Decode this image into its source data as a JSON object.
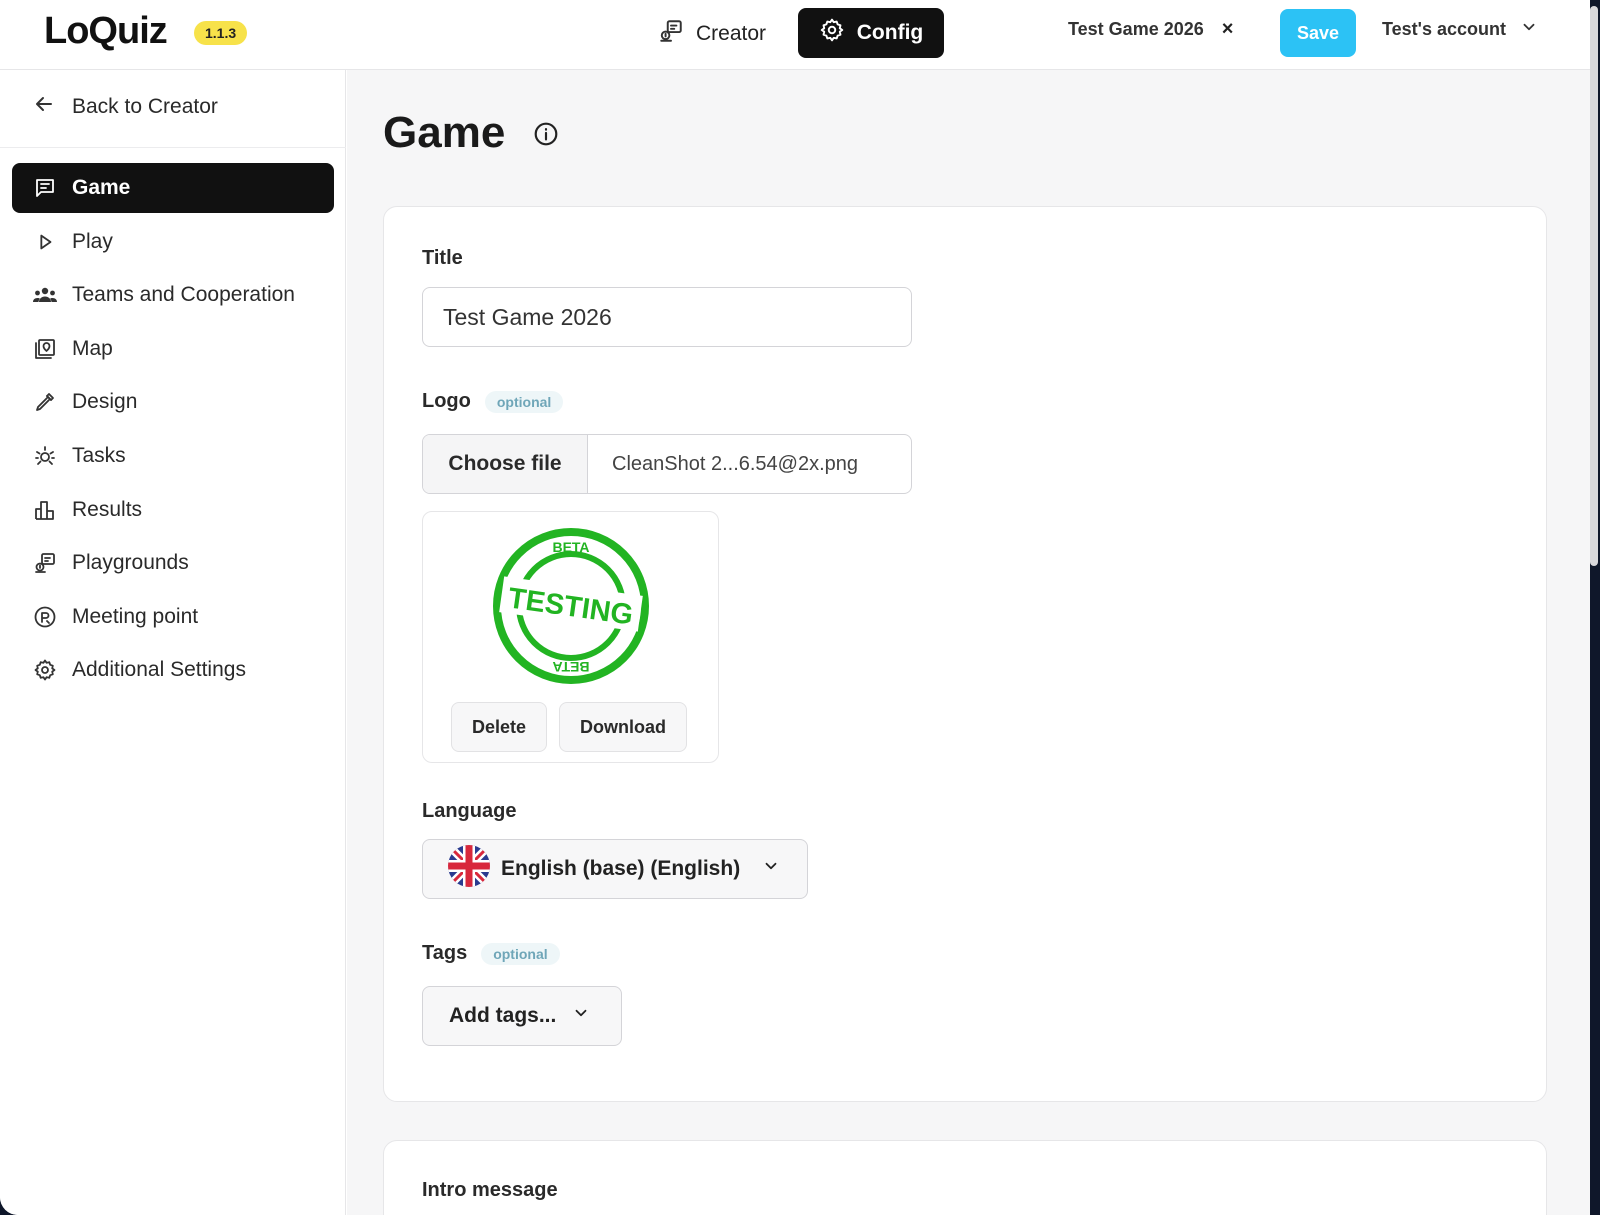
{
  "header": {
    "logo": "LoQuiz",
    "version": "1.1.3",
    "nav_creator": "Creator",
    "nav_config": "Config",
    "game_tab": "Test Game 2026",
    "close_glyph": "×",
    "save_label": "Save",
    "account_label": "Test's account"
  },
  "sidebar": {
    "back_label": "Back to Creator",
    "items": [
      {
        "label": "Game",
        "icon": "message-square-icon",
        "active": true
      },
      {
        "label": "Play",
        "icon": "play-icon"
      },
      {
        "label": "Teams and Cooperation",
        "icon": "users-icon"
      },
      {
        "label": "Map",
        "icon": "map-pin-icon"
      },
      {
        "label": "Design",
        "icon": "pipette-icon"
      },
      {
        "label": "Tasks",
        "icon": "sparkle-icon"
      },
      {
        "label": "Results",
        "icon": "bar-chart-icon"
      },
      {
        "label": "Playgrounds",
        "icon": "playground-icon"
      },
      {
        "label": "Meeting point",
        "icon": "meeting-point-icon"
      },
      {
        "label": "Additional Settings",
        "icon": "gear-icon"
      }
    ]
  },
  "main": {
    "page_title": "Game",
    "title_label": "Title",
    "title_value": "Test Game 2026",
    "logo_label": "Logo",
    "optional_badge": "optional",
    "choose_file_label": "Choose file",
    "file_name": "CleanShot 2...6.54@2x.png",
    "stamp": {
      "top": "BETA",
      "middle": "TESTING",
      "bottom": "BETA",
      "color": "#22b422"
    },
    "delete_label": "Delete",
    "download_label": "Download",
    "language_label": "Language",
    "language_value": "English (base) (English)",
    "tags_label": "Tags",
    "tags_placeholder": "Add tags...",
    "intro_label": "Intro message"
  },
  "colors": {
    "accent": "#2cc2f5",
    "version_badge": "#f7e24a",
    "active_bg": "#111111"
  }
}
